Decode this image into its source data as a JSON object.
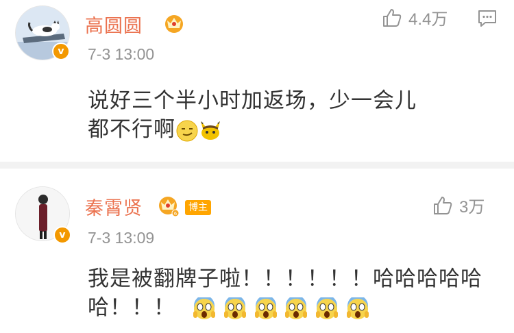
{
  "comments": [
    {
      "username": "高圆圆",
      "time": "7-3 13:00",
      "likes": "4.4万",
      "text_line1": "说好三个半小时加返场，少一会儿",
      "text_line2": "都不行啊",
      "badges": [
        "crown-icon"
      ]
    },
    {
      "username": "秦霄贤",
      "time": "7-3 13:09",
      "likes": "3万",
      "blogger_tag": "博主",
      "text_line1": "我是被翻牌子啦！！！！！！哈哈哈哈哈",
      "text_line2": "哈！！！",
      "badges": [
        "crown-icon",
        "blogger-tag"
      ]
    }
  ],
  "colors": {
    "username": "#eb7350",
    "meta": "#939393",
    "text": "#333333",
    "verified": "#f39800",
    "divider": "#f2f2f2"
  }
}
